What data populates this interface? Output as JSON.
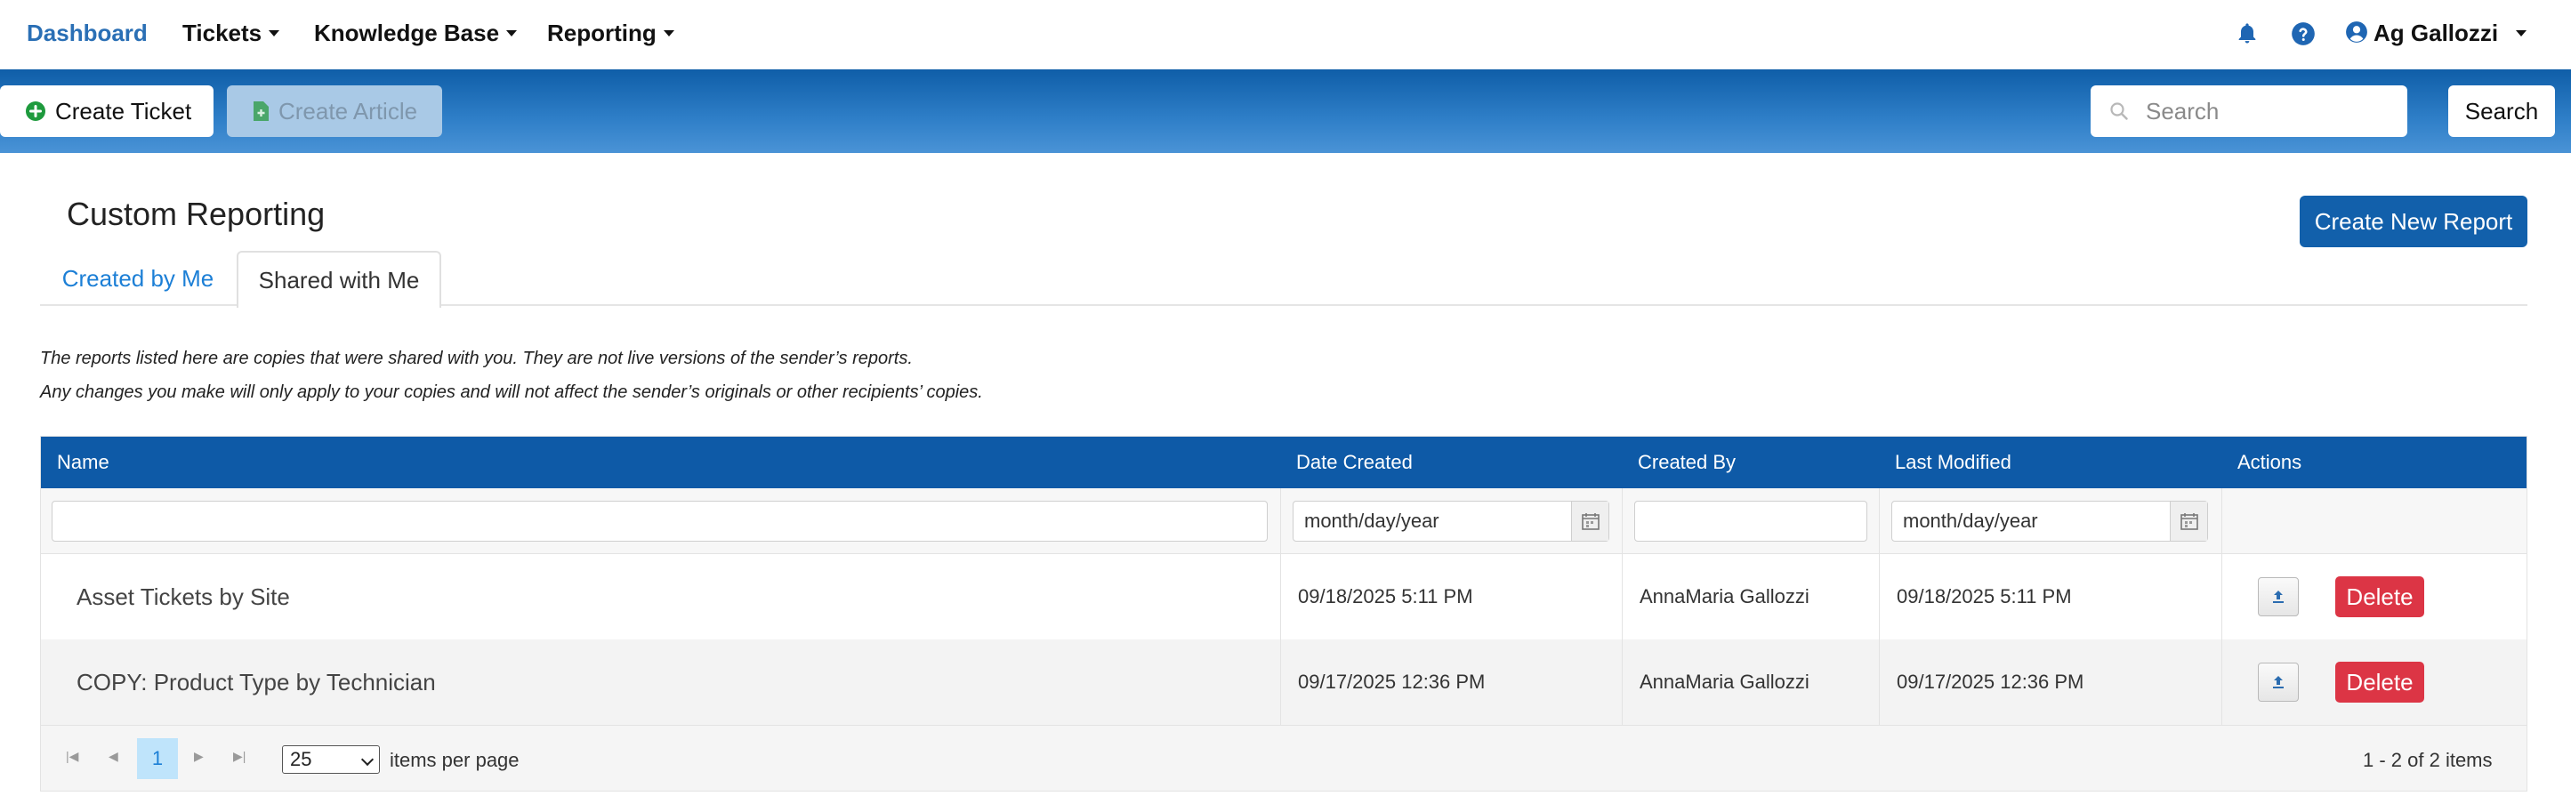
{
  "nav": {
    "dashboard": "Dashboard",
    "tickets": "Tickets",
    "knowledge_base": "Knowledge Base",
    "reporting": "Reporting",
    "user_name": "Ag Gallozzi",
    "icons": [
      "bell-icon",
      "help-icon",
      "user-circle-icon"
    ]
  },
  "toolbar": {
    "create_ticket": "Create Ticket",
    "create_article": "Create Article",
    "search_placeholder": "Search",
    "search_button": "Search"
  },
  "page": {
    "title": "Custom Reporting",
    "create_new_report": "Create New Report",
    "tabs": [
      {
        "label": "Created by Me",
        "active": false
      },
      {
        "label": "Shared with Me",
        "active": true
      }
    ],
    "note_line1": "The reports listed here are copies that were shared with you. They are not live versions of the sender’s reports.",
    "note_line2": "Any changes you make will only apply to your copies and will not affect the sender’s originals or other recipients’ copies."
  },
  "grid": {
    "columns": [
      "Name",
      "Date Created",
      "Created By",
      "Last Modified",
      "Actions"
    ],
    "filters": {
      "name": "",
      "date_created": "month/day/year",
      "created_by": "",
      "last_modified": "month/day/year"
    },
    "rows": [
      {
        "name": "Asset Tickets by Site",
        "date_created": "09/18/2025 5:11 PM",
        "created_by": "AnnaMaria Gallozzi",
        "last_modified": "09/18/2025 5:11 PM",
        "delete": "Delete"
      },
      {
        "name": "COPY: Product Type by Technician",
        "date_created": "09/17/2025 12:36 PM",
        "created_by": "AnnaMaria Gallozzi",
        "last_modified": "09/17/2025 12:36 PM",
        "delete": "Delete"
      }
    ],
    "pager": {
      "current_page": "1",
      "page_size": "25",
      "items_per_page": "items per page",
      "summary": "1 - 2 of 2 items"
    }
  },
  "colors": {
    "brand_blue": "#0e5aa7",
    "link_blue": "#1c7fd6",
    "delete_red": "#dc3545",
    "create_green": "#1e9a3d"
  }
}
